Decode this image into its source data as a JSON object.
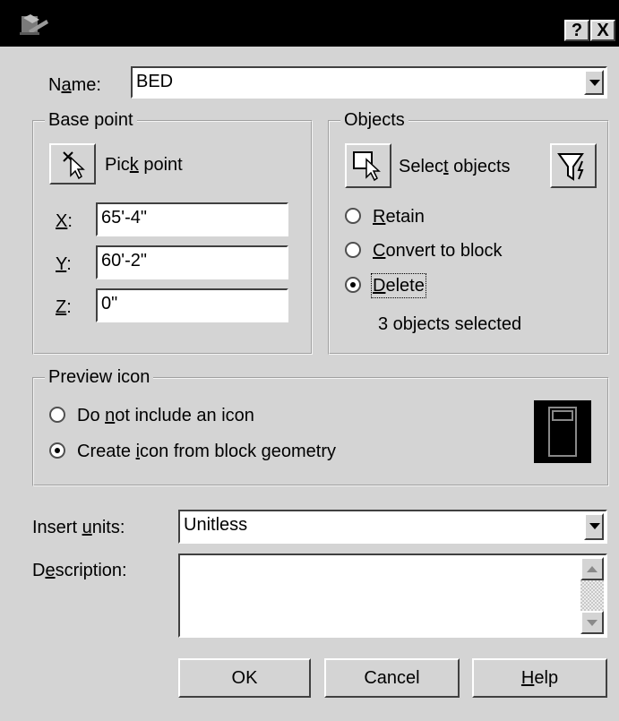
{
  "title_buttons": {
    "help": "?",
    "close": "X"
  },
  "name": {
    "label_pre": "N",
    "label_accel": "a",
    "label_post": "me:",
    "value": "BED"
  },
  "base_point": {
    "title": "Base point",
    "pick_pre": "Pic",
    "pick_accel": "k",
    "pick_post": " point",
    "x_accel": "X",
    "x_post": ":",
    "x_value": "65'-4\"",
    "y_accel": "Y",
    "y_post": ":",
    "y_value": "60'-2\"",
    "z_accel": "Z",
    "z_post": ":",
    "z_value": "0\""
  },
  "objects": {
    "title": "Objects",
    "select_pre": "Selec",
    "select_accel": "t",
    "select_post": " objects",
    "retain_accel": "R",
    "retain_post": "etain",
    "convert_accel": "C",
    "convert_post": "onvert to block",
    "delete_accel": "D",
    "delete_post": "elete",
    "selected_mode": "Delete",
    "count_text": "3 objects selected"
  },
  "preview": {
    "title": "Preview icon",
    "no_icon_pre": "Do ",
    "no_icon_accel": "n",
    "no_icon_post": "ot include an icon",
    "create_pre": "Create ",
    "create_accel": "i",
    "create_post": "con from block geometry",
    "selected": "Create icon from block geometry"
  },
  "insert_units": {
    "label_pre": "Insert ",
    "label_accel": "u",
    "label_post": "nits:",
    "value": "Unitless"
  },
  "description": {
    "label_pre": "D",
    "label_accel": "e",
    "label_post": "scription:",
    "value": ""
  },
  "buttons": {
    "ok": "OK",
    "cancel": "Cancel",
    "help_accel": "H",
    "help_post": "elp"
  }
}
